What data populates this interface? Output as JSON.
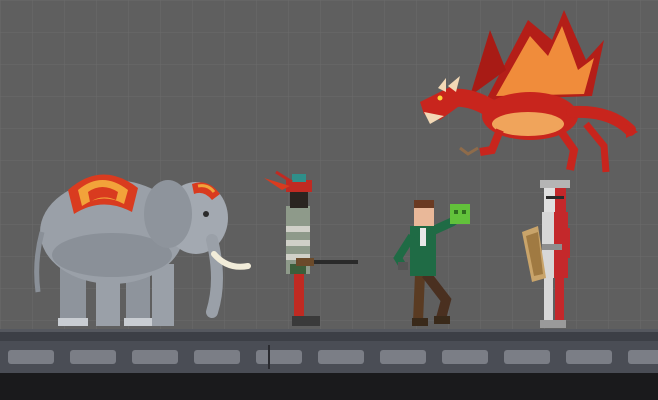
{
  "scene": {
    "kind": "side-view sandbox game scene",
    "colors": {
      "background": "#5f5f5f",
      "grid_line": "#6b6b6b",
      "floor_top": "#3c3f46",
      "floor_brick": "#7b7e86",
      "floor_bottom": "#1a1a1c"
    },
    "entities": [
      {
        "id": "elephant",
        "type": "war elephant",
        "icon": "elephant-icon",
        "color": "#9aa0a8",
        "accent": "#d93b1f"
      },
      {
        "id": "warrior",
        "type": "turbaned warrior with rifle",
        "icon": "warrior-icon",
        "color": "#8e9a8a",
        "accent": "#c02a22"
      },
      {
        "id": "man",
        "type": "man holding green cube",
        "icon": "person-icon",
        "color": "#1f6b45",
        "accent": "#62c13b"
      },
      {
        "id": "knight",
        "type": "red and white armored knight with shield",
        "icon": "knight-icon",
        "color": "#d7d7d7",
        "accent": "#c4282b"
      },
      {
        "id": "dragon",
        "type": "red flying dragon",
        "icon": "dragon-icon",
        "color": "#c8251d",
        "accent": "#f08c3b"
      }
    ]
  }
}
